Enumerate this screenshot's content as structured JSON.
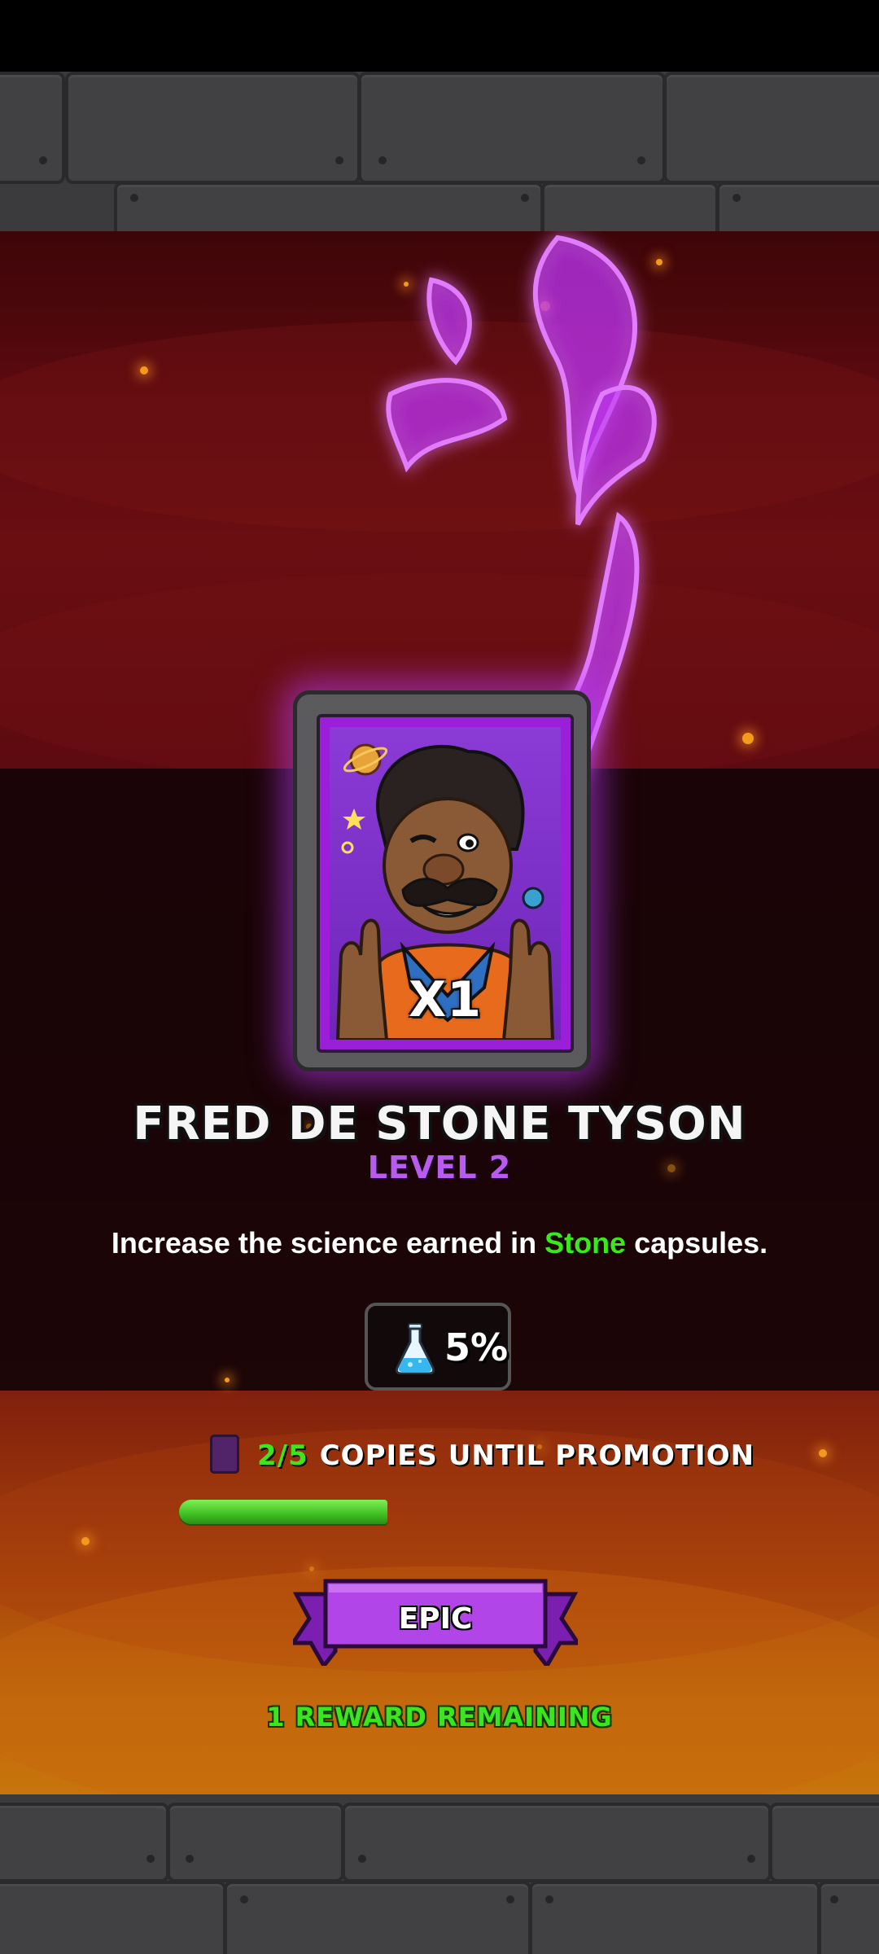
{
  "card": {
    "count_label": "X1",
    "character_name": "FRED DE STONE TYSON",
    "level_label": "LEVEL 2",
    "rarity": "EPIC",
    "portrait_icon": "scientist-portrait",
    "frame_color": "#9b1fd8"
  },
  "description": {
    "before": "Increase the science earned in ",
    "highlight": "Stone",
    "after": " capsules."
  },
  "stat": {
    "icon": "flask-icon",
    "value": "5%"
  },
  "promotion": {
    "icon": "card-copies-icon",
    "count": "2/5",
    "label": "COPIES UNTIL PROMOTION",
    "progress_fraction": 0.4
  },
  "footer": {
    "remaining_label": "1 REWARD REMAINING"
  },
  "colors": {
    "accent_green": "#3ce61f",
    "epic_purple": "#b85cf0"
  }
}
